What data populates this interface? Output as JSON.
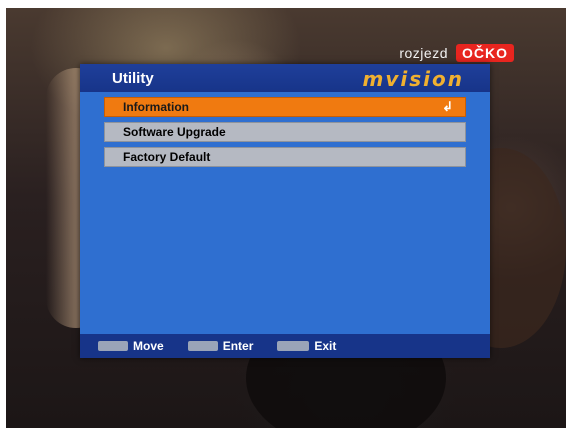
{
  "channel": {
    "prefix": "rozjezd",
    "name": "OČKO"
  },
  "menu": {
    "title": "Utility",
    "brand": "mvision",
    "items": [
      {
        "label": "Information",
        "selected": true,
        "enter_icon": "↲"
      },
      {
        "label": "Software Upgrade",
        "selected": false
      },
      {
        "label": "Factory Default",
        "selected": false
      }
    ]
  },
  "footer": {
    "hints": [
      {
        "label": "Move",
        "icon": "move-key-icon"
      },
      {
        "label": "Enter",
        "icon": "ok-key-icon"
      },
      {
        "label": "Exit",
        "icon": "menu-key-icon"
      }
    ]
  },
  "colors": {
    "panel": "#2f6fd0",
    "header": "#173489",
    "selected": "#f07a10",
    "item": "#b5b9c2",
    "channel_logo": "#e8251f",
    "brand": "#f0b030"
  }
}
